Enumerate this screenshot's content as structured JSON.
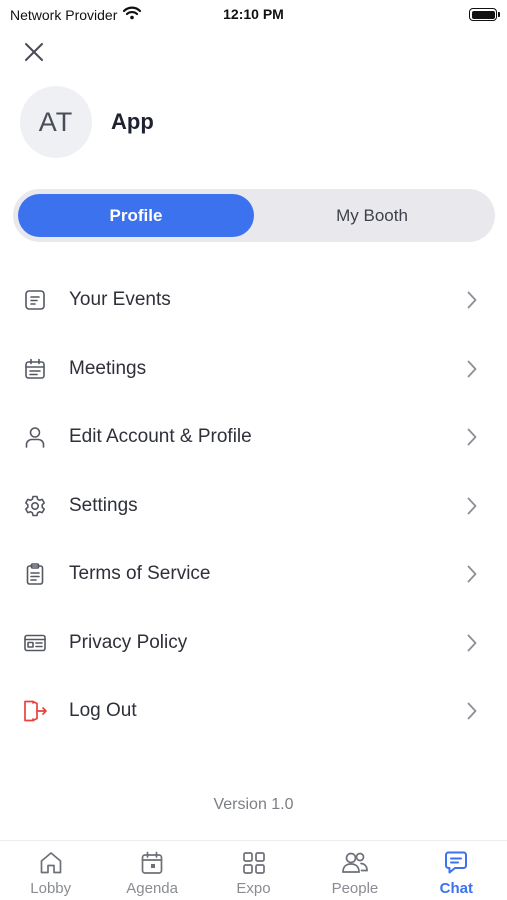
{
  "status_bar": {
    "carrier": "Network Provider",
    "time": "12:10 PM"
  },
  "profile": {
    "initials": "AT",
    "name": "App"
  },
  "segments": [
    {
      "label": "Profile",
      "active": true
    },
    {
      "label": "My Booth",
      "active": false
    }
  ],
  "menu": [
    {
      "label": "Your Events",
      "icon": "events-icon"
    },
    {
      "label": "Meetings",
      "icon": "calendar-icon"
    },
    {
      "label": "Edit Account & Profile",
      "icon": "user-icon"
    },
    {
      "label": "Settings",
      "icon": "gear-icon"
    },
    {
      "label": "Terms of Service",
      "icon": "clipboard-icon"
    },
    {
      "label": "Privacy Policy",
      "icon": "id-card-icon"
    },
    {
      "label": "Log Out",
      "icon": "logout-icon"
    }
  ],
  "version": "Version 1.0",
  "tabs": [
    {
      "label": "Lobby",
      "icon": "home-icon",
      "active": false
    },
    {
      "label": "Agenda",
      "icon": "agenda-icon",
      "active": false
    },
    {
      "label": "Expo",
      "icon": "grid-icon",
      "active": false
    },
    {
      "label": "People",
      "icon": "people-icon",
      "active": false
    },
    {
      "label": "Chat",
      "icon": "chat-icon",
      "active": true
    }
  ],
  "colors": {
    "accent": "#3d72ee",
    "logout": "#e8423f",
    "icon_gray": "#555861",
    "tab_gray": "#8a8c94"
  }
}
